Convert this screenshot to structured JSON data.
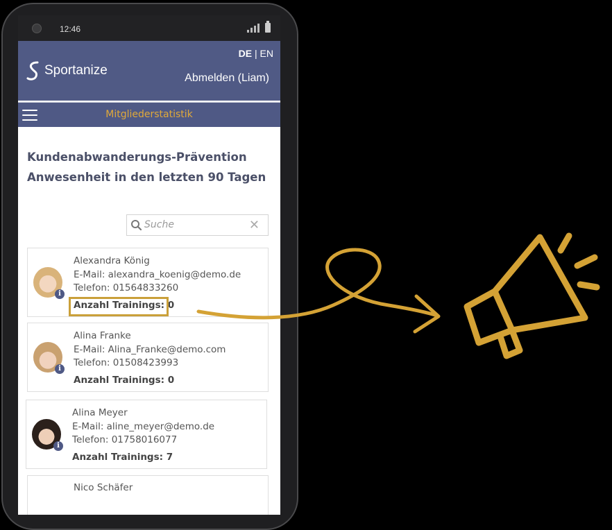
{
  "status_bar": {
    "time": "12:46"
  },
  "header": {
    "brand": "Sportanize",
    "lang_active": "DE",
    "lang_separator": "|",
    "lang_other": "EN",
    "logout": "Abmelden (Liam)"
  },
  "nav": {
    "title": "Mitgliederstatistik"
  },
  "page": {
    "title_line1": "Kundenabwanderungs-Prävention",
    "title_line2": "Anwesenheit in den letzten 90 Tagen"
  },
  "search": {
    "placeholder": "Suche"
  },
  "members": [
    {
      "name": "Alexandra König",
      "email": "E-Mail: alexandra_koenig@demo.de",
      "phone": "Telefon: 01564833260",
      "trainings": "Anzahl Trainings: 0"
    },
    {
      "name": "Alina Franke",
      "email": "E-Mail: Alina_Franke@demo.com",
      "phone": "Telefon: 01508423993",
      "trainings": "Anzahl Trainings: 0"
    },
    {
      "name": "Alina Meyer",
      "email": "E-Mail: aline_meyer@demo.de",
      "phone": "Telefon: 01758016077",
      "trainings": "Anzahl Trainings: 7"
    },
    {
      "name": "Nico Schäfer"
    }
  ],
  "colors": {
    "header_bg": "#505a85",
    "accent_gold": "#d4a235",
    "title_text": "#4b5068"
  },
  "icons": [
    "camera-icon",
    "signal-icon",
    "battery-icon",
    "brand-logo-icon",
    "menu-icon",
    "search-icon",
    "clear-icon",
    "info-icon",
    "megaphone-icon",
    "curly-arrow-icon"
  ]
}
